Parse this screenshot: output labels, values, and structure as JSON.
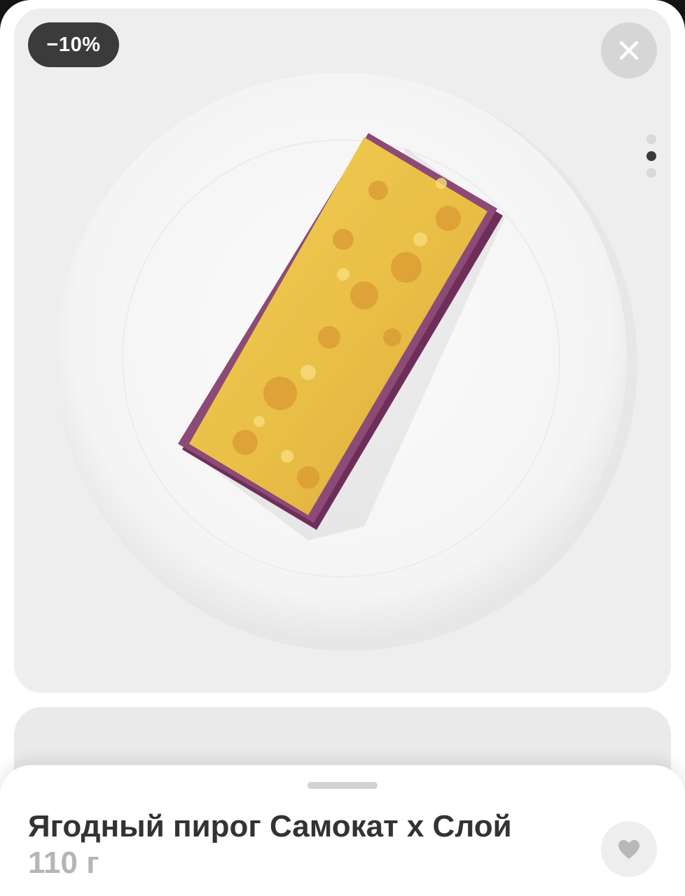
{
  "product": {
    "title": "Ягодный пирог Самокат х Слой",
    "weight": "110 г",
    "discount": "−10%"
  },
  "gallery": {
    "total_images": 3,
    "active_index": 2
  },
  "icons": {
    "close": "close-icon",
    "favorite": "heart-icon"
  },
  "colors": {
    "badge_bg": "#3b3b3b",
    "title_text": "#333333",
    "weight_text": "#b5b5b5",
    "card_bg": "#eeeeee"
  }
}
